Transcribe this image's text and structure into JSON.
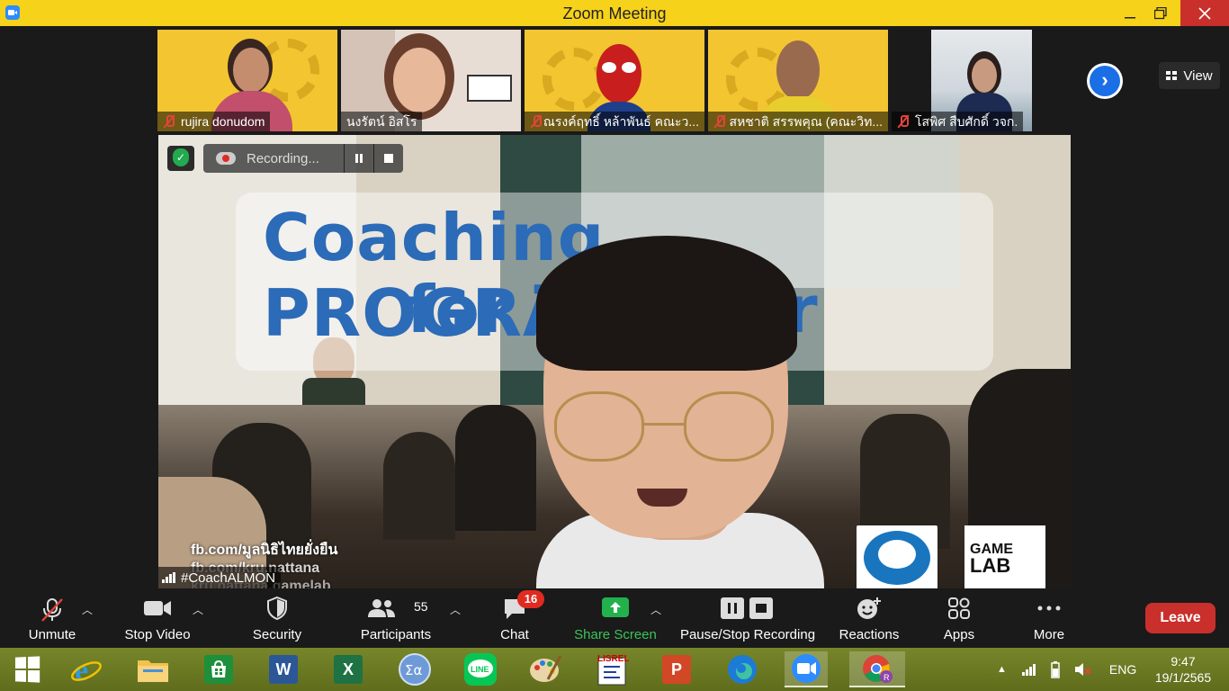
{
  "window": {
    "title": "Zoom Meeting"
  },
  "gallery": {
    "participants": [
      {
        "name": "rujira donudom",
        "muted": true
      },
      {
        "name": "นงรัตน์ อิสโร",
        "muted": false
      },
      {
        "name": "ณรงค์ฤทธิ์ หล้าพันธ์ คณะว...",
        "muted": true
      },
      {
        "name": "สหชาติ สรรพคุณ (คณะวิท...",
        "muted": true
      },
      {
        "name": "โสพิศ สืบศักดิ์ วจก.",
        "muted": true
      }
    ],
    "next_label": "›",
    "view_label": "View"
  },
  "main": {
    "banner_line1": "Coaching PROGRAM",
    "banner_line2": "for Teacher",
    "recording_label": "Recording...",
    "fb_line1": "fb.com/มูลนิธิไทยยั่งยืน",
    "fb_line2": "fb.com/kru.nattana",
    "fb_line3": "kru.nattana.gamelab",
    "logo2_line1": "GAME",
    "logo2_line2": "LAB",
    "speaker_name": "#CoachALMON"
  },
  "toolbar": {
    "unmute": "Unmute",
    "stop_video": "Stop Video",
    "security": "Security",
    "participants": "Participants",
    "participants_count": "55",
    "chat": "Chat",
    "chat_badge": "16",
    "share_screen": "Share Screen",
    "pause_stop_recording": "Pause/Stop Recording",
    "reactions": "Reactions",
    "apps": "Apps",
    "more": "More",
    "leave": "Leave"
  },
  "taskbar": {
    "language": "ENG",
    "time": "9:47",
    "date": "19/1/2565"
  },
  "colors": {
    "title_bar": "#f7d21a",
    "leave": "#c9302c",
    "share_green": "#39c55a",
    "taskbar": "#6c7a22"
  }
}
